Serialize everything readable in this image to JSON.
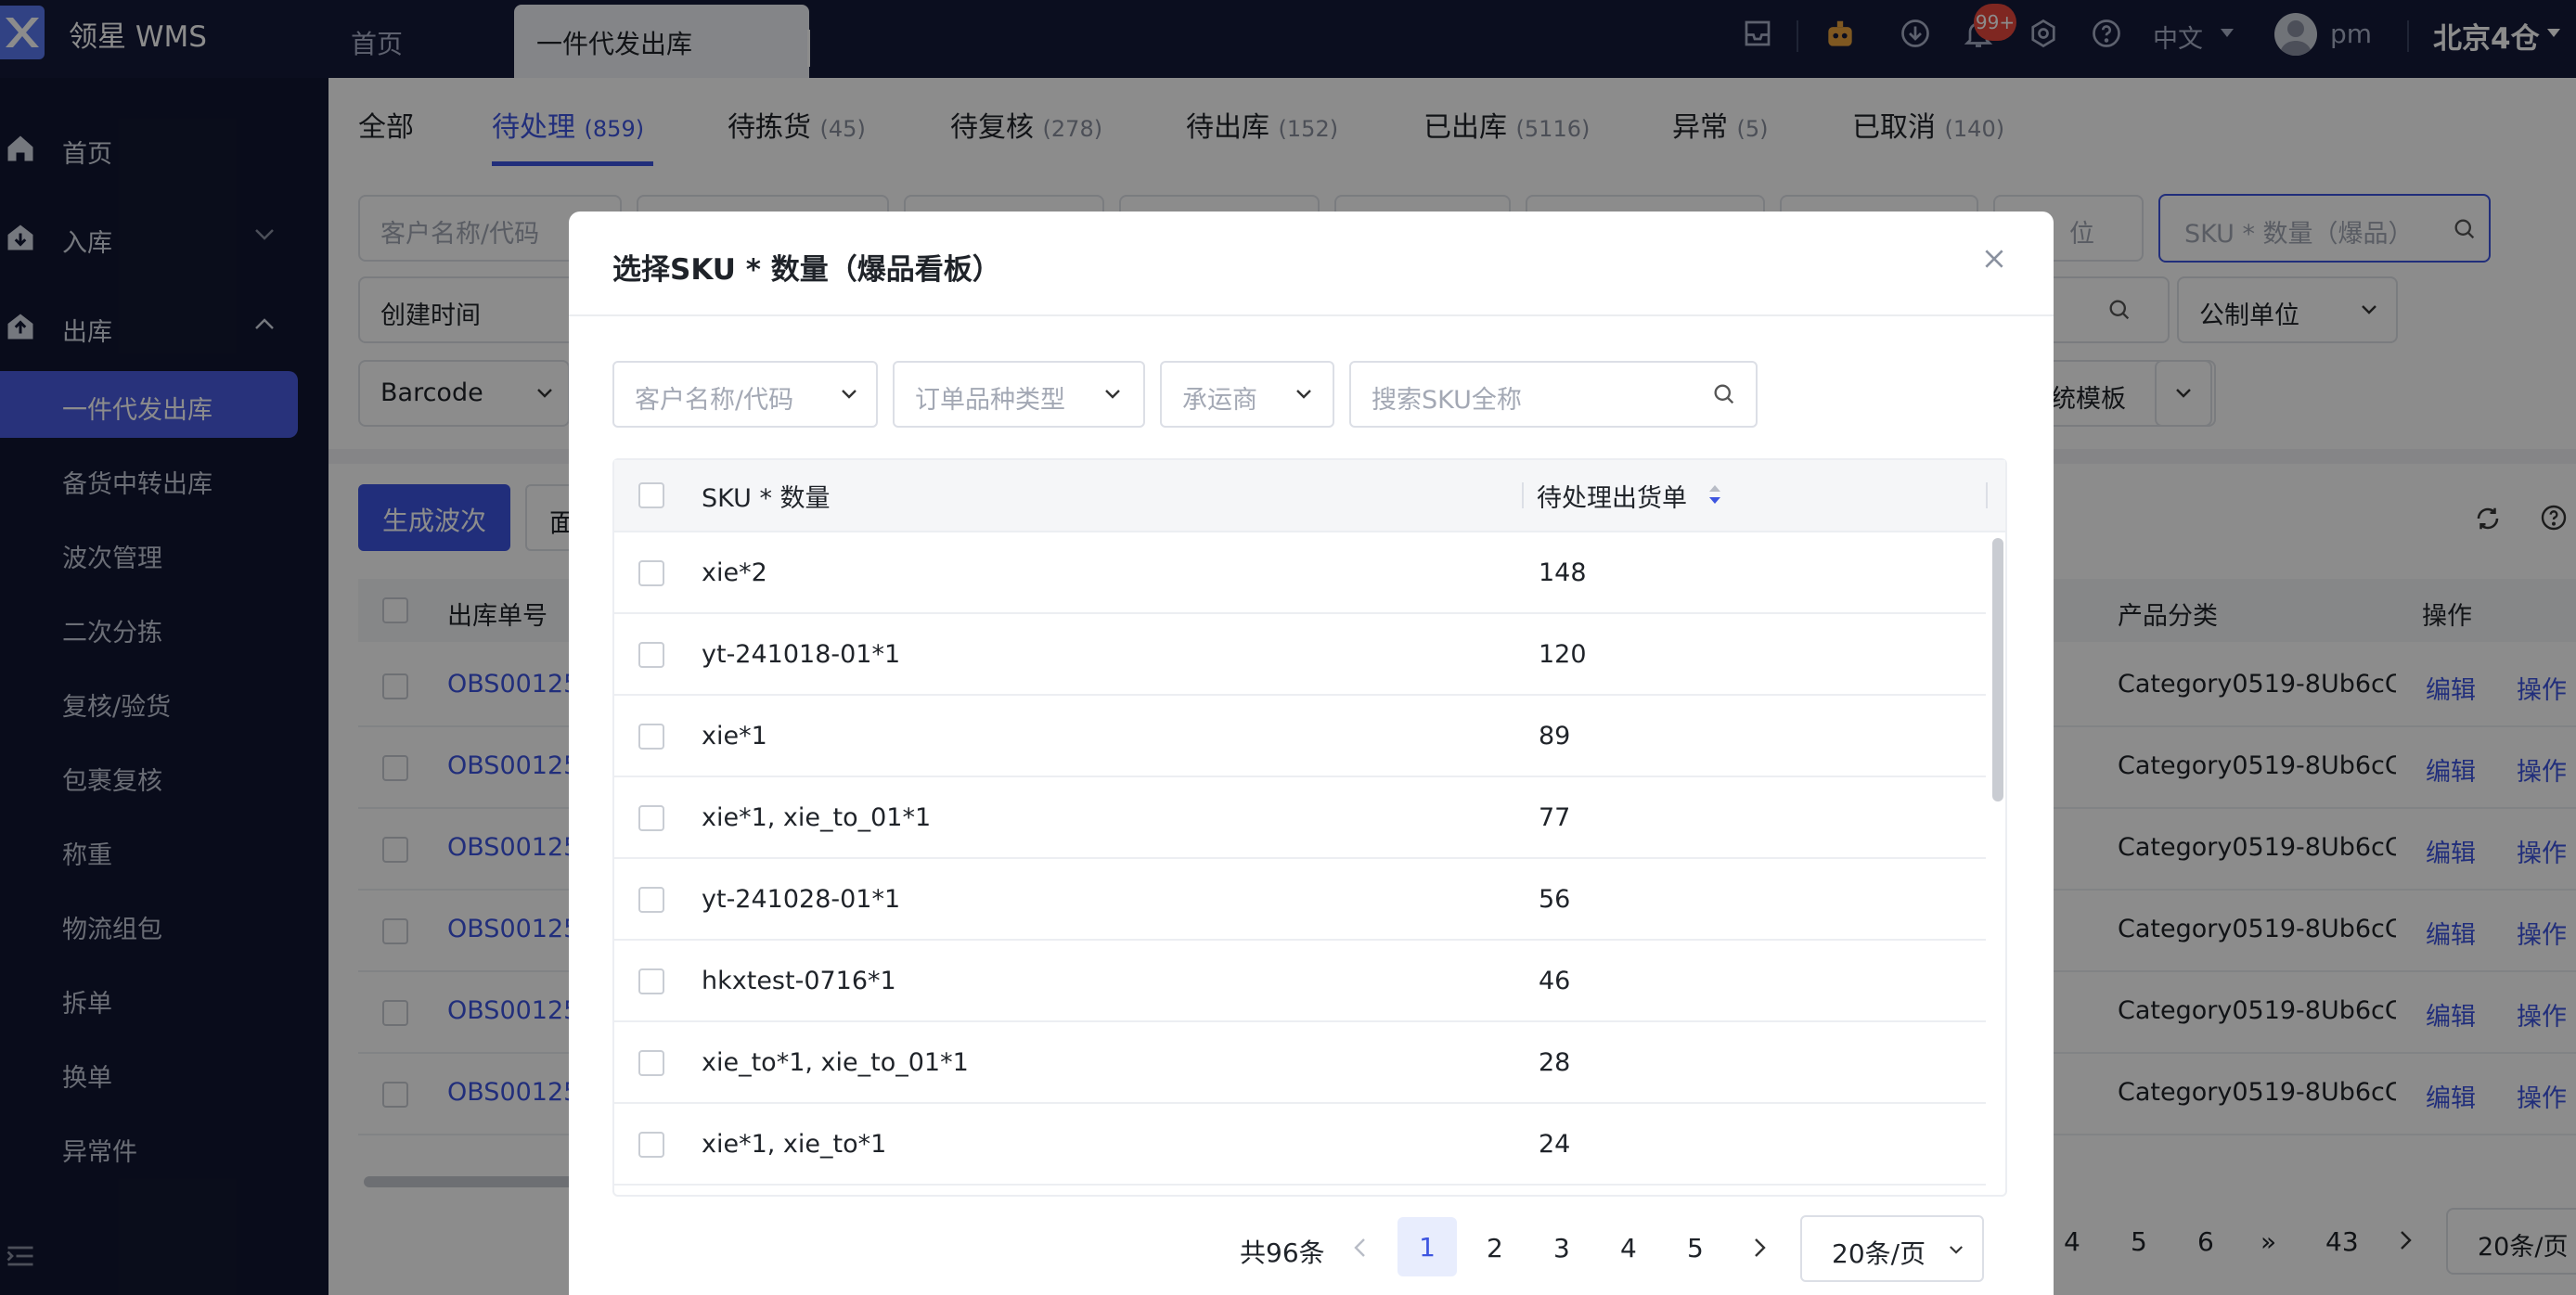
{
  "app": {
    "title": "领星 WMS",
    "warehouse": "北京4仓",
    "user": "pm",
    "language": "中文",
    "notification_badge": "99+"
  },
  "nav_tabs": [
    {
      "label": "首页"
    },
    {
      "label": "一件代发出库"
    }
  ],
  "sidebar": {
    "items": [
      {
        "label": "首页",
        "icon": "home-icon"
      },
      {
        "label": "入库",
        "icon": "inbound-icon"
      },
      {
        "label": "出库",
        "icon": "outbound-icon"
      }
    ],
    "sub_items": [
      {
        "label": "一件代发出库",
        "active": true
      },
      {
        "label": "备货中转出库"
      },
      {
        "label": "波次管理"
      },
      {
        "label": "二次分拣"
      },
      {
        "label": "复核/验货"
      },
      {
        "label": "包裹复核"
      },
      {
        "label": "称重"
      },
      {
        "label": "物流组包"
      },
      {
        "label": "拆单"
      },
      {
        "label": "换单"
      },
      {
        "label": "异常件"
      }
    ]
  },
  "status_tabs": [
    {
      "label": "全部",
      "count": ""
    },
    {
      "label": "待处理",
      "count": "(859)"
    },
    {
      "label": "待拣货",
      "count": "(45)"
    },
    {
      "label": "待复核",
      "count": "(278)"
    },
    {
      "label": "待出库",
      "count": "(152)"
    },
    {
      "label": "已出库",
      "count": "(5116)"
    },
    {
      "label": "异常",
      "count": "(5)"
    },
    {
      "label": "已取消",
      "count": "(140)"
    }
  ],
  "filters": {
    "customer_placeholder": "客户名称/代码",
    "sku_qty_placeholder": "SKU * 数量（爆品）",
    "create_time": "创建时间",
    "barcode": "Barcode",
    "unit": "公制单位",
    "unit_partial": "位",
    "template": "统模板"
  },
  "list": {
    "generate_wave_button": "生成波次",
    "second_button_partial": "面",
    "columns": {
      "order_no": "出库单号",
      "category": "产品分类",
      "actions": "操作"
    },
    "rows": [
      {
        "order_no": "OBS00125",
        "category": "Category0519-8Ub6cC",
        "edit": "编辑",
        "op": "操作"
      },
      {
        "order_no": "OBS00125",
        "category": "Category0519-8Ub6cC",
        "edit": "编辑",
        "op": "操作"
      },
      {
        "order_no": "OBS00125",
        "category": "Category0519-8Ub6cC",
        "edit": "编辑",
        "op": "操作"
      },
      {
        "order_no": "OBS00125",
        "category": "Category0519-8Ub6cC",
        "edit": "编辑",
        "op": "操作"
      },
      {
        "order_no": "OBS00125",
        "category": "Category0519-8Ub6cC",
        "edit": "编辑",
        "op": "操作"
      },
      {
        "order_no": "OBS00125",
        "category": "Category0519-8Ub6cC",
        "edit": "编辑",
        "op": "操作"
      }
    ],
    "pagination": {
      "pages": [
        "4",
        "5",
        "6"
      ],
      "jump": "»",
      "last": "43",
      "page_size": "20条/页"
    }
  },
  "modal": {
    "title": "选择SKU * 数量（爆品看板）",
    "filters": {
      "customer": "客户名称/代码",
      "order_type": "订单品种类型",
      "carrier": "承运商",
      "search_placeholder": "搜索SKU全称"
    },
    "columns": {
      "sku_qty": "SKU * 数量",
      "pending_orders": "待处理出货单"
    },
    "rows": [
      {
        "sku": "xie*2",
        "count": "148"
      },
      {
        "sku": "yt-241018-01*1",
        "count": "120"
      },
      {
        "sku": "xie*1",
        "count": "89"
      },
      {
        "sku": "xie*1, xie_to_01*1",
        "count": "77"
      },
      {
        "sku": "yt-241028-01*1",
        "count": "56"
      },
      {
        "sku": "hkxtest-0716*1",
        "count": "46"
      },
      {
        "sku": "xie_to*1, xie_to_01*1",
        "count": "28"
      },
      {
        "sku": "xie*1, xie_to*1",
        "count": "24"
      }
    ],
    "pagination": {
      "total": "共96条",
      "current": "1",
      "pages": [
        "2",
        "3",
        "4",
        "5"
      ],
      "page_size": "20条/页"
    }
  },
  "colors": {
    "primary": "#3d55e0",
    "topbar": "#151b3a",
    "sidebar": "#121732",
    "sidebar_active": "#4a5be0",
    "badge": "#e8473c"
  }
}
